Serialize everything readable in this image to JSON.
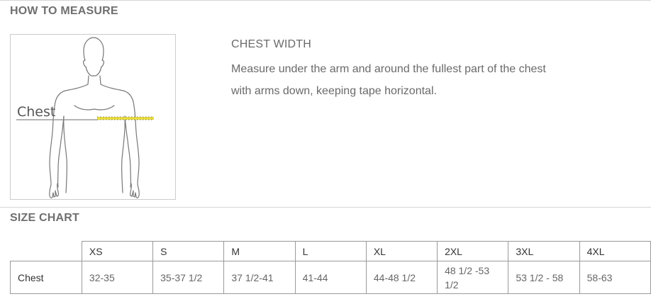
{
  "measure": {
    "section_title": "HOW TO MEASURE",
    "figure_label": "Chest",
    "heading": "CHEST WIDTH",
    "line1": "Measure under the arm and around the fullest part of the chest",
    "line2": "with arms down, keeping tape horizontal."
  },
  "size_chart": {
    "section_title": "SIZE CHART",
    "headers": [
      "XS",
      "S",
      "M",
      "L",
      "XL",
      "2XL",
      "3XL",
      "4XL"
    ],
    "rows": [
      {
        "label": "Chest",
        "values": [
          "32-35",
          "35-37 1/2",
          "37 1/2-41",
          "41-44",
          "44-48 1/2",
          "48 1/2 -53 1/2",
          "53 1/2 - 58",
          "58-63"
        ]
      }
    ]
  },
  "colors": {
    "tape": "#e8dd3c",
    "rule": "#d4d4d4",
    "border": "#9a9a9a"
  }
}
